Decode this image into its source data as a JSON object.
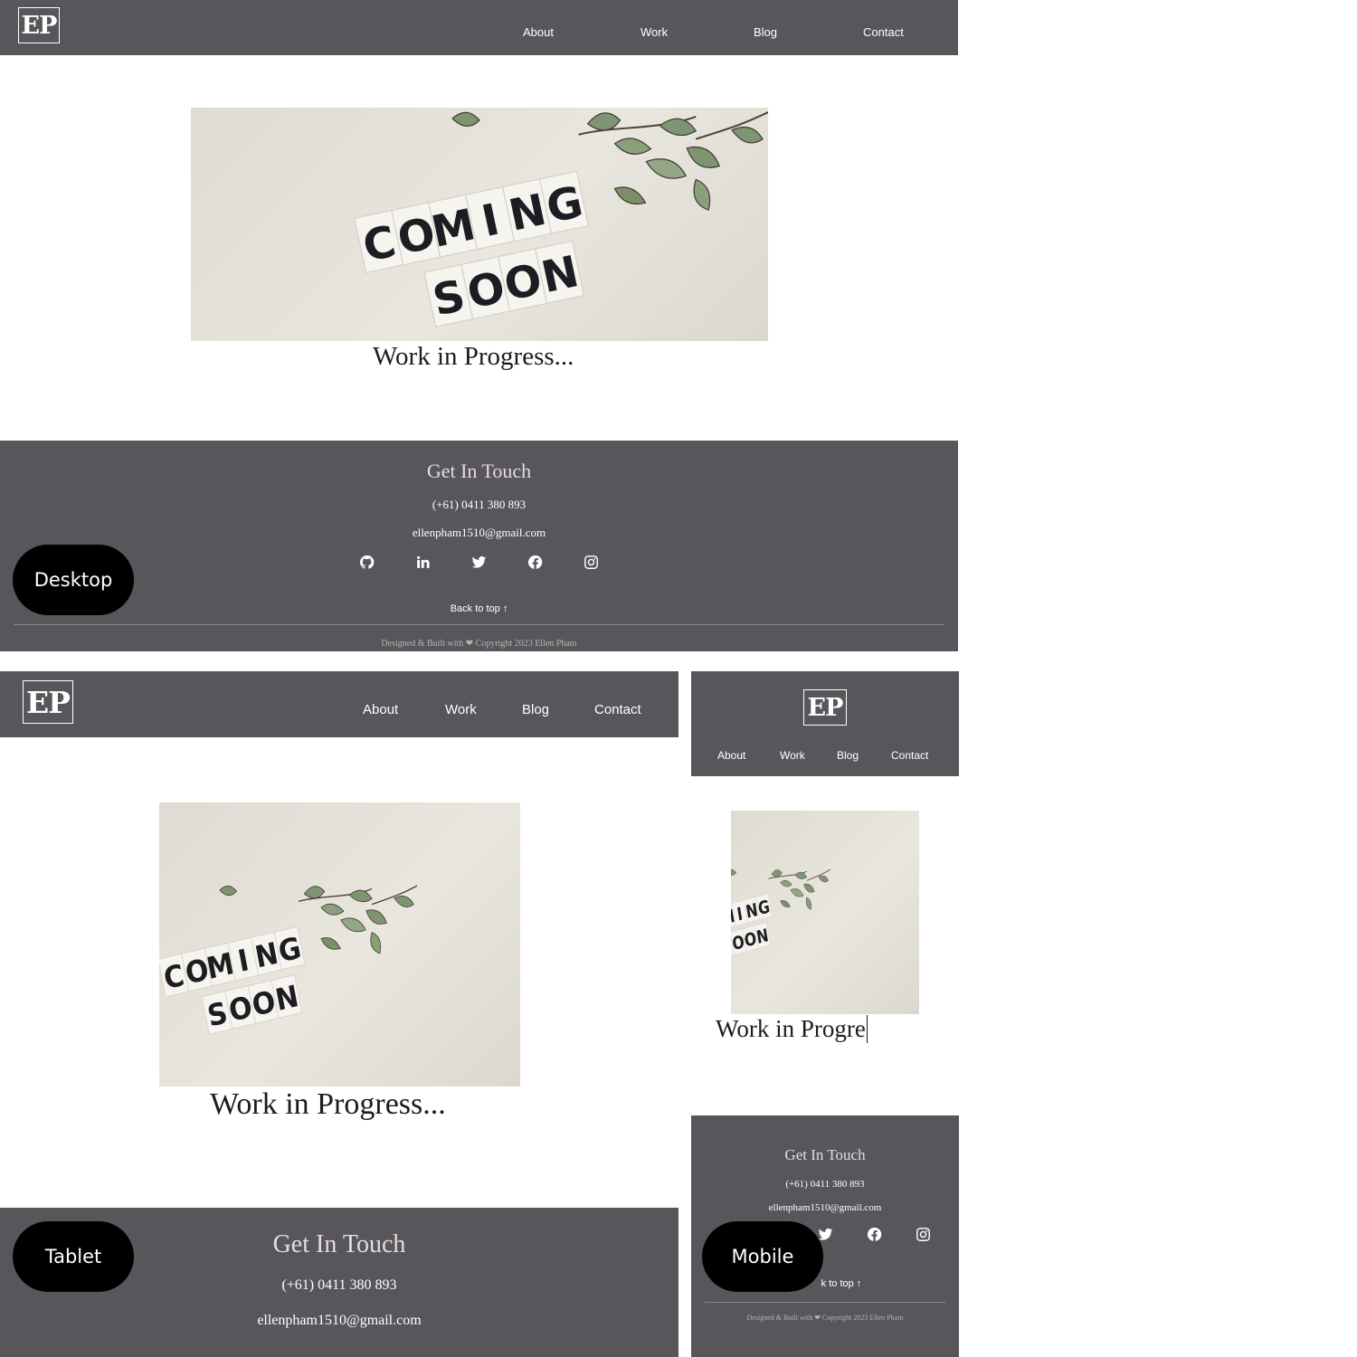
{
  "brand": {
    "logo": "EP"
  },
  "nav": {
    "about": "About",
    "work": "Work",
    "blog": "Blog",
    "contact": "Contact"
  },
  "hero": {
    "line1": "COMING",
    "line2": "SOON"
  },
  "main": {
    "heading": "Work in Progress...",
    "heading_mobile": "Work in Progre"
  },
  "footer": {
    "title": "Get In Touch",
    "phone": "(+61) 0411 380 893",
    "email": "ellenpham1510@gmail.com",
    "social_icons": [
      "github-icon",
      "linkedin-icon",
      "twitter-icon",
      "facebook-icon",
      "instagram-icon"
    ],
    "back_to_top": "Back to top ↑",
    "back_to_top_mobile": "k to top ↑",
    "credits": "Designed & Built with ❤ Copyright 2023 Ellen Pham"
  },
  "labels": {
    "desktop": "Desktop",
    "tablet": "Tablet",
    "mobile": "Mobile"
  },
  "colors": {
    "header_bg": "#58565b",
    "footer_bg": "#58565b",
    "text_dark": "#1d1b1e",
    "label_bg": "#000000"
  }
}
